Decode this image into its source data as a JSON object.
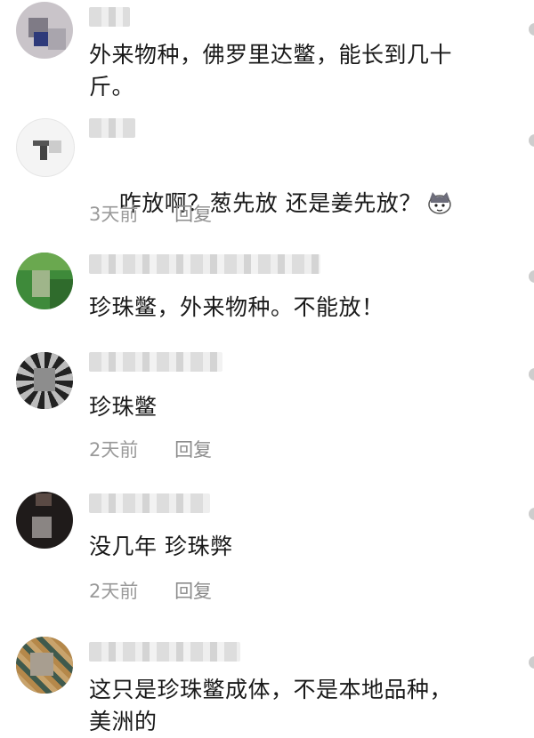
{
  "comments": [
    {
      "text": "外来物种，佛罗里达鳖，能长到几十\n斤。",
      "time": "",
      "reply": ""
    },
    {
      "text": "咋放啊？葱先放 还是姜先放？",
      "emoji": "cat-face-icon",
      "time": "3天前",
      "reply": "回复"
    },
    {
      "text": "珍珠鳖，外来物种。不能放！",
      "time": "",
      "reply": ""
    },
    {
      "text": "珍珠鳖",
      "time": "2天前",
      "reply": "回复"
    },
    {
      "text": "没几年 珍珠弊",
      "time": "2天前",
      "reply": "回复"
    },
    {
      "text": "这只是珍珠鳖成体，不是本地品种，\n美洲的",
      "time": "",
      "reply": ""
    }
  ]
}
